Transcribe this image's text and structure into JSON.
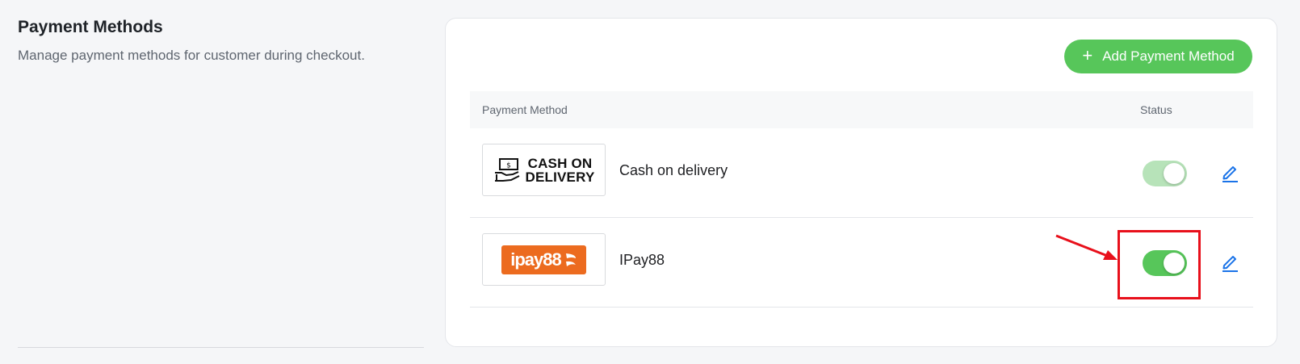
{
  "section": {
    "title": "Payment Methods",
    "description": "Manage payment methods for customer during checkout."
  },
  "card": {
    "add_button_label": "Add Payment Method",
    "columns": {
      "method": "Payment Method",
      "status": "Status"
    },
    "rows": [
      {
        "name": "Cash on delivery",
        "logo_text_line1": "CASH ON",
        "logo_text_line2": "DELIVERY",
        "enabled": true,
        "toggle_color": "#b7e3b9"
      },
      {
        "name": "IPay88",
        "logo_text": "ipay88",
        "enabled": true,
        "toggle_color": "#57c65a"
      }
    ]
  },
  "colors": {
    "accent": "#57c65a",
    "link": "#1a73e8",
    "annotation": "#e8101b",
    "ipay_brand": "#ec6b1f"
  }
}
